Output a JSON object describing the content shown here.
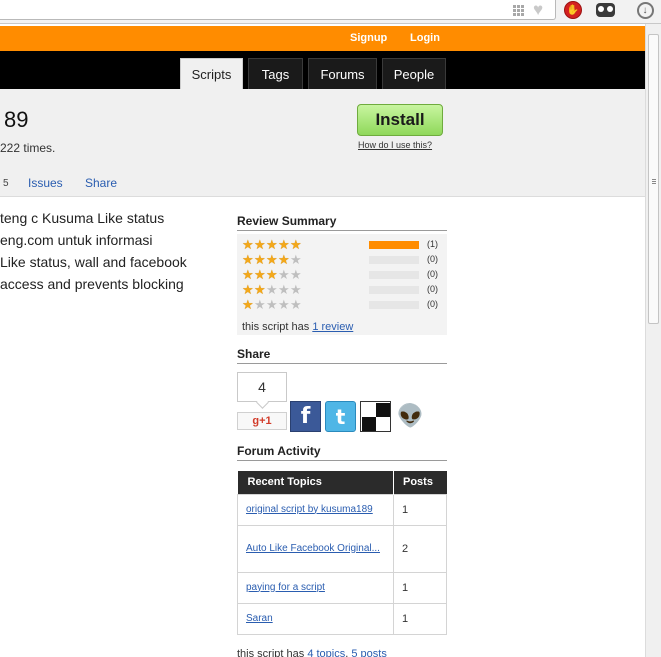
{
  "nav": {
    "signup": "Signup",
    "login": "Login",
    "tabs": [
      "Scripts",
      "Tags",
      "Forums",
      "People"
    ]
  },
  "header": {
    "title_fragment": "89",
    "installs_fragment": "222 times.",
    "install_label": "Install",
    "howto_label": "How do I use this?",
    "subtabs": {
      "count": "5",
      "issues": "Issues",
      "share": "Share"
    }
  },
  "description": {
    "lines": [
      "teng c Kusuma Like status",
      "eng.com untuk informasi",
      "Like status, wall and facebook",
      "access and prevents blocking"
    ]
  },
  "review_summary": {
    "title": "Review Summary",
    "rows": [
      {
        "stars": 5,
        "count": "(1)",
        "fraction": 1.0
      },
      {
        "stars": 4,
        "count": "(0)",
        "fraction": 0
      },
      {
        "stars": 3,
        "count": "(0)",
        "fraction": 0
      },
      {
        "stars": 2,
        "count": "(0)",
        "fraction": 0
      },
      {
        "stars": 1,
        "count": "(0)",
        "fraction": 0
      }
    ],
    "footer_prefix": "this script has",
    "footer_link": "1 review"
  },
  "share": {
    "title": "Share",
    "count": "4",
    "gplus_label": "g+1",
    "icons": [
      "facebook-icon",
      "twitter-icon",
      "delicious-icon",
      "reddit-icon"
    ]
  },
  "forum": {
    "title": "Forum Activity",
    "col_topics": "Recent Topics",
    "col_posts": "Posts",
    "topics": [
      {
        "title": "original script by kusuma189",
        "posts": "1"
      },
      {
        "title": "Auto Like Facebook Original...",
        "posts": "2"
      },
      {
        "title": "paying for a script",
        "posts": "1"
      },
      {
        "title": "Saran",
        "posts": "1"
      }
    ],
    "footer_prefix": "this script has",
    "footer_topics": "4 topics",
    "footer_sep": ",",
    "footer_posts": "5 posts"
  },
  "colors": {
    "accent": "#ff8c00",
    "nav": "#000000",
    "install": "#8fd85a",
    "link": "#2a5db0"
  }
}
